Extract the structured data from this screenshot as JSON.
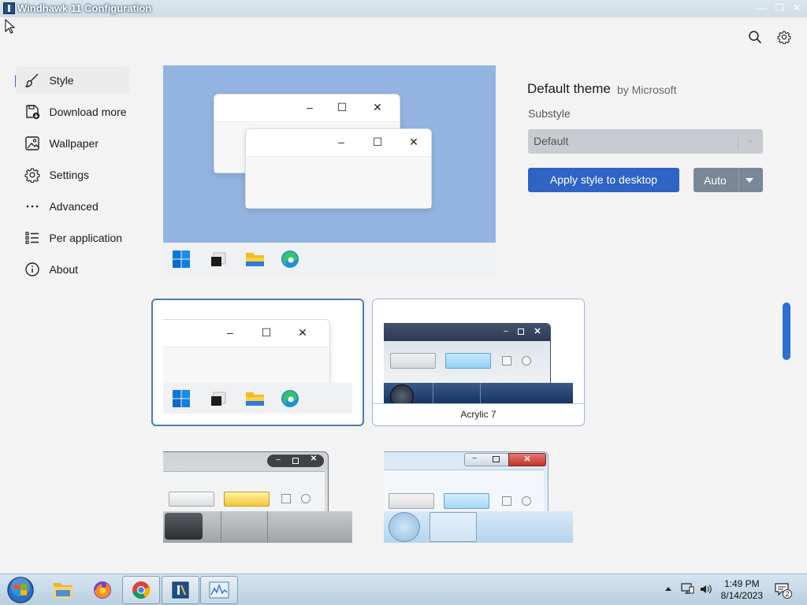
{
  "window": {
    "title": "Windhawk 11 Configuration",
    "minimize_glyph": "—",
    "maximize_glyph": "❐",
    "close_glyph": "✕"
  },
  "toolbar": {
    "search_icon": "search-icon",
    "settings_icon": "gear-icon"
  },
  "sidebar": {
    "items": [
      {
        "label": "Style",
        "icon": "brush-icon",
        "active": true
      },
      {
        "label": "Download more styles",
        "icon": "download-icon"
      },
      {
        "label": "Wallpaper",
        "icon": "image-icon"
      },
      {
        "label": "Settings",
        "icon": "gear-icon"
      },
      {
        "label": "Advanced",
        "icon": "more-icon"
      },
      {
        "label": "Per application",
        "icon": "list-icon"
      },
      {
        "label": "About",
        "icon": "info-icon"
      }
    ]
  },
  "theme": {
    "name": "Default theme",
    "author": "by Microsoft",
    "substyle_label": "Substyle",
    "substyle_value": "Default",
    "apply_label": "Apply style to desktop",
    "mode_label": "Auto"
  },
  "gallery": {
    "cards": [
      {
        "name": "",
        "selected": true
      },
      {
        "name": "Acrylic 7",
        "selected": false
      },
      {
        "name": "",
        "selected": false
      },
      {
        "name": "",
        "selected": false
      }
    ]
  },
  "ostaskbar": {
    "time": "1:49 PM",
    "date": "8/14/2023",
    "notification_count": "2"
  },
  "colors": {
    "accent": "#2f64c4",
    "preview_background": "#93b4e0",
    "scrollbar": "#2f6fd0"
  }
}
